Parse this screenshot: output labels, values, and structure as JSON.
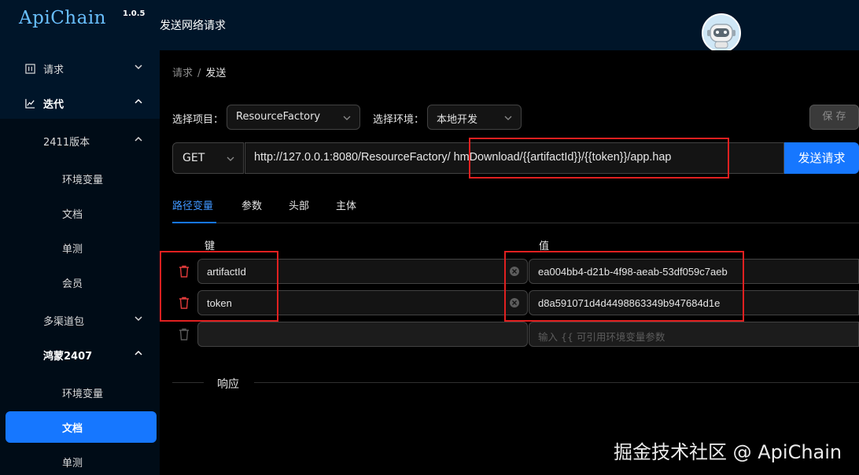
{
  "app": {
    "name": "ApiChain",
    "version": "1.0.5"
  },
  "header": {
    "title": "发送网络请求"
  },
  "sidebar": {
    "items": [
      {
        "label": "请求",
        "icon": "layout-icon"
      },
      {
        "label": "迭代",
        "icon": "line-chart-icon"
      }
    ],
    "iteration_group": {
      "label": "2411版本"
    },
    "iteration_children": [
      "环境变量",
      "文档",
      "单测",
      "会员"
    ],
    "group2": {
      "label": "多渠道包"
    },
    "group3": {
      "label": "鸿蒙2407"
    },
    "group3_children": [
      "环境变量",
      "文档",
      "单测"
    ]
  },
  "breadcrumb": {
    "prev": "请求",
    "separator": "/",
    "current": "发送"
  },
  "form": {
    "project_label": "选择项目：",
    "project_value": "ResourceFactory",
    "env_label": "选择环境：",
    "env_value": "本地开发",
    "save_label": "保 存"
  },
  "request": {
    "method": "GET",
    "url_prefix": "http://127.0.0.1:8080/ResourceFactory/",
    "url_path": "hmDownload/{{artifactId}}/{{token}}/app.hap",
    "send_label": "发送请求"
  },
  "tabs": [
    "路径变量",
    "参数",
    "头部",
    "主体"
  ],
  "path_vars": {
    "key_header": "键",
    "value_header": "值",
    "rows": [
      {
        "key": "artifactId",
        "value": "ea004bb4-d21b-4f98-aeab-53df059c7aeb"
      },
      {
        "key": "token",
        "value": "d8a591071d4d4498863349b947684d1e"
      }
    ],
    "value_placeholder": "输入 {{ 可引用环境变量参数"
  },
  "response": {
    "title": "响应"
  },
  "watermark": "掘金技术社区 @ ApiChain",
  "colors": {
    "accent": "#1677ff",
    "sider": "#001529",
    "highlight": "#e02020"
  }
}
